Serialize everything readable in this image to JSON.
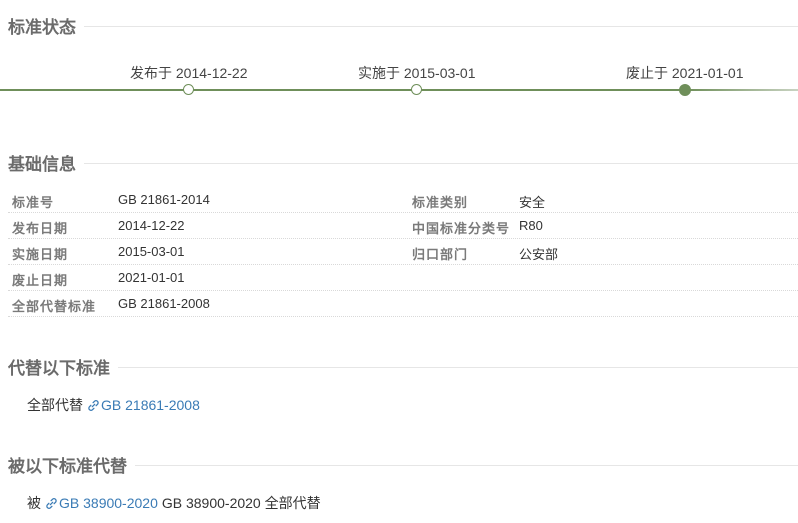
{
  "status": {
    "title": "标准状态",
    "events": [
      {
        "label": "发布于 2014-12-22"
      },
      {
        "label": "实施于 2015-03-01"
      },
      {
        "label": "废止于 2021-01-01"
      }
    ]
  },
  "basic": {
    "title": "基础信息",
    "rows": [
      {
        "k": "标准号",
        "v": "GB 21861-2014",
        "k2": "标准类别",
        "v2": "安全"
      },
      {
        "k": "发布日期",
        "v": "2014-12-22",
        "k2": "中国标准分类号",
        "v2": "R80"
      },
      {
        "k": "实施日期",
        "v": "2015-03-01",
        "k2": "归口部门",
        "v2": "公安部"
      },
      {
        "k": "废止日期",
        "v": "2021-01-01"
      },
      {
        "k": "全部代替标准",
        "v": "GB 21861-2008"
      }
    ]
  },
  "replaces": {
    "title": "代替以下标准",
    "prefix": "全部代替",
    "link": "GB 21861-2008"
  },
  "replaced_by": {
    "title": "被以下标准代替",
    "prefix": "被",
    "link": "GB 38900-2020",
    "suffix": "GB 38900-2020 全部代替"
  },
  "colors": {
    "accent": "#6f8f5a",
    "link": "#3a7bb5"
  }
}
